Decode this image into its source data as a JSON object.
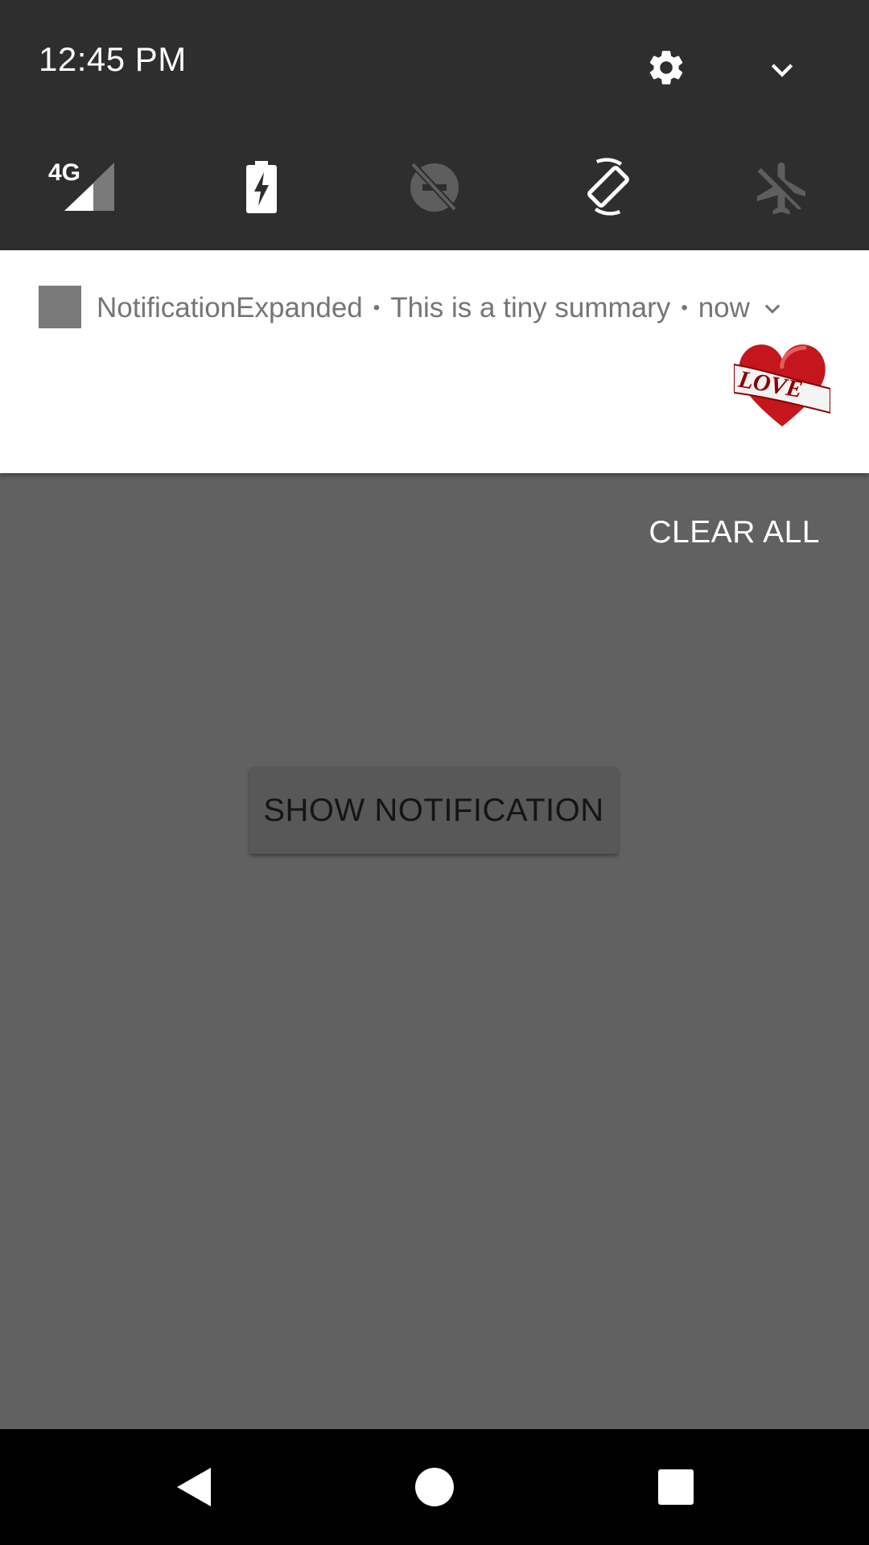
{
  "status": {
    "time": "12:45 PM"
  },
  "quick_settings": {
    "top_icons": [
      "gear-icon",
      "chevron-down-icon"
    ],
    "tiles": [
      {
        "name": "cellular-4g",
        "label": "4G",
        "icon": "signal-icon"
      },
      {
        "name": "battery-saver",
        "icon": "battery-charging-icon"
      },
      {
        "name": "do-not-disturb",
        "icon": "dnd-off-icon"
      },
      {
        "name": "auto-rotate",
        "icon": "rotate-icon"
      },
      {
        "name": "airplane-mode",
        "icon": "airplane-off-icon"
      }
    ]
  },
  "notification": {
    "app_name": "NotificationExpanded",
    "separator": "•",
    "summary": "This is a tiny summary",
    "time": "now",
    "large_icon": "love-heart-image",
    "large_icon_text": "LOVE"
  },
  "shade": {
    "clear_all_label": "CLEAR ALL"
  },
  "app": {
    "button_label": "SHOW NOTIFICATION"
  },
  "navbar": {
    "buttons": [
      "back-icon",
      "home-icon",
      "recents-icon"
    ]
  },
  "colors": {
    "panel": "#2e2e2e",
    "scrim": "#616161",
    "notification_bg": "#ffffff",
    "heart_red": "#c4161c"
  }
}
